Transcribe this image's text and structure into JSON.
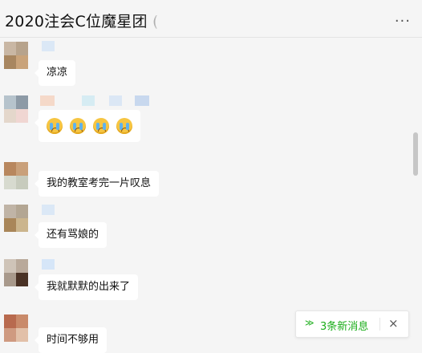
{
  "window": {
    "title": "2020注会C位魔星团 (",
    "more_icon": "more-icon"
  },
  "messages": [
    {
      "type": "text",
      "text": "凉凉"
    },
    {
      "type": "emoji",
      "emoji_count": 4,
      "emoji_icon": "crying-face-icon"
    },
    {
      "type": "text",
      "text": "我的教室考完一片叹息"
    },
    {
      "type": "text",
      "text": "还有骂娘的"
    },
    {
      "type": "text",
      "text": "我就默默的出来了"
    },
    {
      "type": "text",
      "text": "时间不够用"
    }
  ],
  "new_messages": {
    "label": "3条新消息",
    "close": "×",
    "chevron": "≫",
    "accent": "#1aad19"
  }
}
